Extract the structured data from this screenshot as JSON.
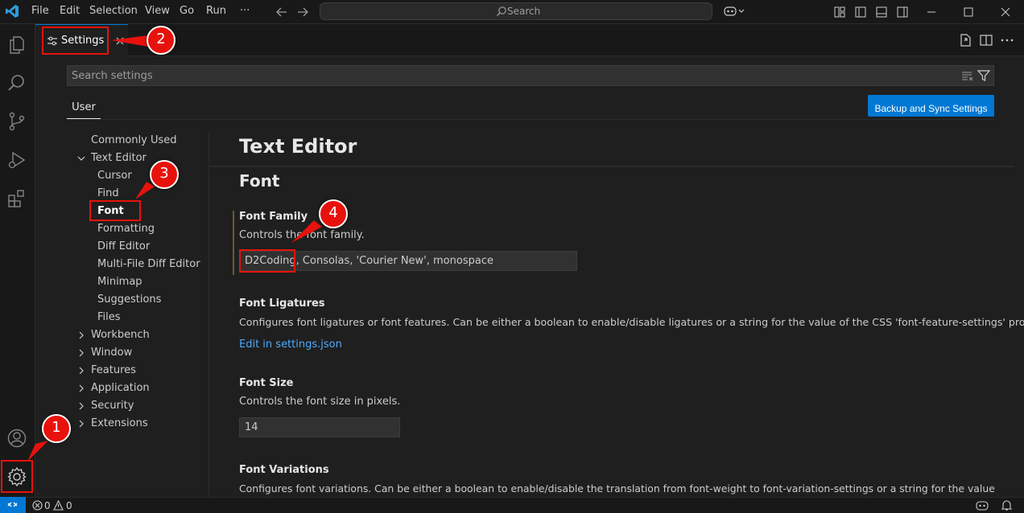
{
  "titlebar": {
    "menu": [
      "File",
      "Edit",
      "Selection",
      "View",
      "Go",
      "Run",
      "···"
    ],
    "search_label": "Search"
  },
  "tab": {
    "label": "Settings"
  },
  "settings_search": {
    "placeholder": "Search settings"
  },
  "scope_tab": {
    "label": "User"
  },
  "sync_button": {
    "label": "Backup and Sync Settings"
  },
  "toc": {
    "items": [
      {
        "label": "Commonly Used"
      },
      {
        "label": "Text Editor"
      },
      {
        "label": "Cursor"
      },
      {
        "label": "Find"
      },
      {
        "label": "Font"
      },
      {
        "label": "Formatting"
      },
      {
        "label": "Diff Editor"
      },
      {
        "label": "Multi-File Diff Editor"
      },
      {
        "label": "Minimap"
      },
      {
        "label": "Suggestions"
      },
      {
        "label": "Files"
      },
      {
        "label": "Workbench"
      },
      {
        "label": "Window"
      },
      {
        "label": "Features"
      },
      {
        "label": "Application"
      },
      {
        "label": "Security"
      },
      {
        "label": "Extensions"
      }
    ]
  },
  "content": {
    "section_title": "Text Editor",
    "subsection_title": "Font",
    "settings": [
      {
        "title": "Font Family",
        "description": "Controls the font family.",
        "value": "D2Coding, Consolas, 'Courier New', monospace"
      },
      {
        "title": "Font Ligatures",
        "description": "Configures font ligatures or font features. Can be either a boolean to enable/disable ligatures or a string for the value of the CSS 'font-feature-settings' property.",
        "link": "Edit in settings.json"
      },
      {
        "title": "Font Size",
        "description": "Controls the font size in pixels.",
        "value": "14"
      },
      {
        "title": "Font Variations",
        "description": "Configures font variations. Can be either a boolean to enable/disable the translation from font-weight to font-variation-settings or a string for the value of the"
      }
    ]
  },
  "statusbar": {
    "errors": "0",
    "warnings": "0"
  },
  "annotations": [
    "1",
    "2",
    "3",
    "4"
  ],
  "colors": {
    "accent": "#0078d4",
    "annotation": "#e8120c",
    "link": "#4daafc"
  }
}
